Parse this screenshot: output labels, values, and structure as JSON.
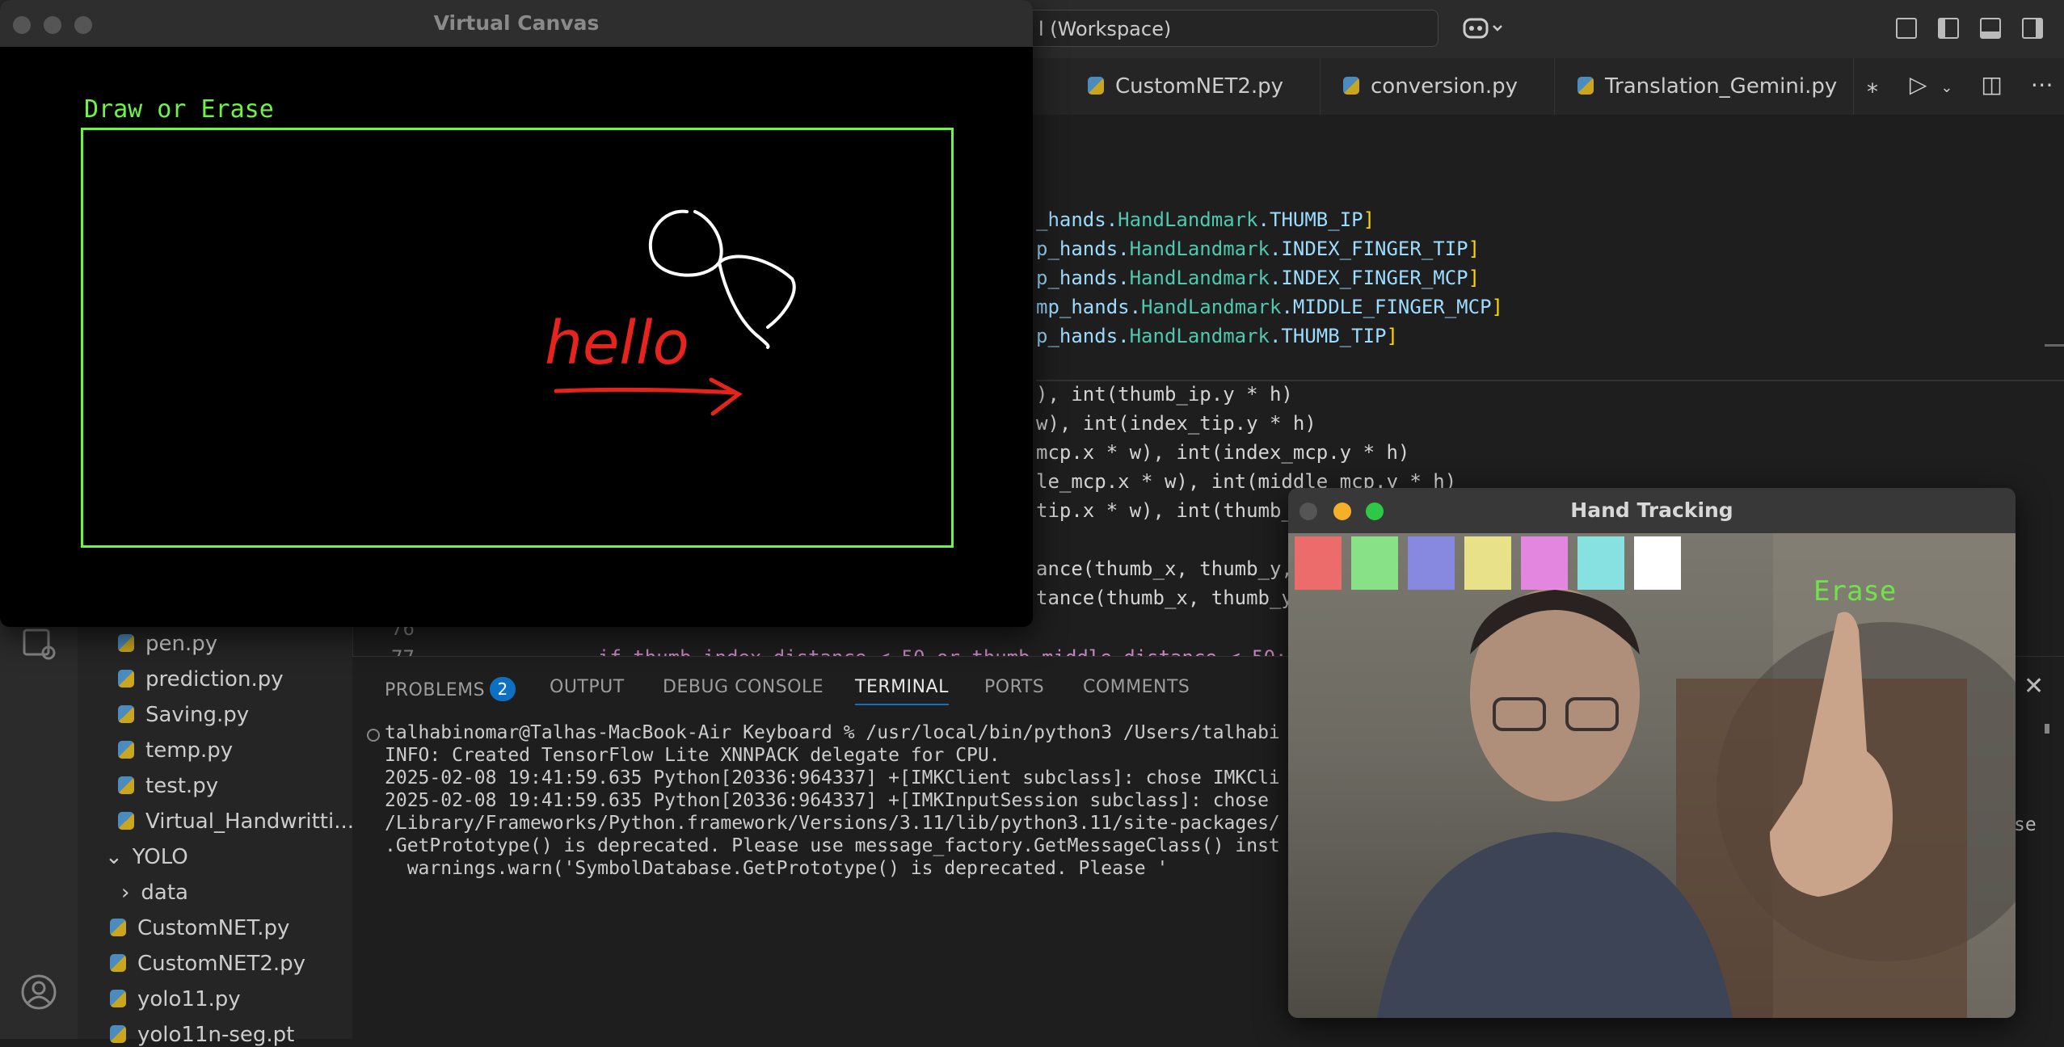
{
  "vscode": {
    "command_center": "l (Workspace)",
    "tabs": [
      "CustomNET2.py",
      "conversion.py",
      "Translation_Gemini.py"
    ],
    "code_lines_top": [
      {
        "pre": "_hands.",
        "mid": "HandLandmark",
        "post": ".THUMB_IP]"
      },
      {
        "pre": "p_hands.",
        "mid": "HandLandmark",
        "post": ".INDEX_FINGER_TIP]"
      },
      {
        "pre": "p_hands.",
        "mid": "HandLandmark",
        "post": ".INDEX_FINGER_MCP]"
      },
      {
        "pre": "mp_hands.",
        "mid": "HandLandmark",
        "post": ".MIDDLE_FINGER_MCP]"
      },
      {
        "pre": "p_hands.",
        "mid": "HandLandmark",
        "post": ".THUMB_TIP]"
      }
    ],
    "code_lines_bottom": [
      "), int(thumb_ip.y * h)",
      "w), int(index_tip.y * h)",
      "mcp.x * w), int(index_mcp.y * h)",
      "le_mcp.x * w), int(middle_mcp.y * h)",
      "tip.x * w), int(thumb_",
      "",
      "ance(thumb_x, thumb_y,",
      "tance(thumb_x, thumb_y"
    ],
    "line_number": "76",
    "line_number_2": "77",
    "partial_code": "if thumb_index_distance < 50 or thumb_middle_distance < 50:",
    "sidebar_files": [
      "pen.py",
      "prediction.py",
      "Saving.py",
      "temp.py",
      "test.py",
      "Virtual_Handwritti..."
    ],
    "sidebar_folder": "YOLO",
    "sidebar_subfolder": "data",
    "sidebar_files_2": [
      "CustomNET.py",
      "CustomNET2.py",
      "yolo11.py",
      "yolo11n-seg.pt"
    ],
    "panel_tabs": {
      "problems": "PROBLEMS",
      "problems_count": "2",
      "output": "OUTPUT",
      "debug": "DEBUG CONSOLE",
      "terminal": "TERMINAL",
      "ports": "PORTS",
      "comments": "COMMENTS"
    },
    "terminal_lines": [
      "talhabinomar@Talhas-MacBook-Air Keyboard % /usr/local/bin/python3 /Users/talhabi",
      "INFO: Created TensorFlow Lite XNNPACK delegate for CPU.",
      "2025-02-08 19:41:59.635 Python[20336:964337] +[IMKClient subclass]: chose IMKCli",
      "2025-02-08 19:41:59.635 Python[20336:964337] +[IMKInputSession subclass]: chose",
      "/Library/Frameworks/Python.framework/Versions/3.11/lib/python3.11/site-packages/",
      ".GetPrototype() is deprecated. Please use message_factory.GetMessageClass() inst",
      "  warnings.warn('SymbolDatabase.GetPrototype() is deprecated. Please '"
    ],
    "terminal_edge": "se"
  },
  "canvas_window": {
    "title": "Virtual Canvas",
    "label": "Draw or Erase",
    "hello_text": "hello"
  },
  "tracking_window": {
    "title": "Hand Tracking",
    "erase_label": "Erase",
    "swatches": [
      "#ff6b6b",
      "#8cf58c",
      "#8a8cf5",
      "#fbf58e",
      "#f58af5",
      "#8af5f5",
      "#ffffff"
    ]
  },
  "colors": {
    "accent": "#0e70c0",
    "canvas_frame": "#6cf542",
    "ink": "#e8231e"
  }
}
